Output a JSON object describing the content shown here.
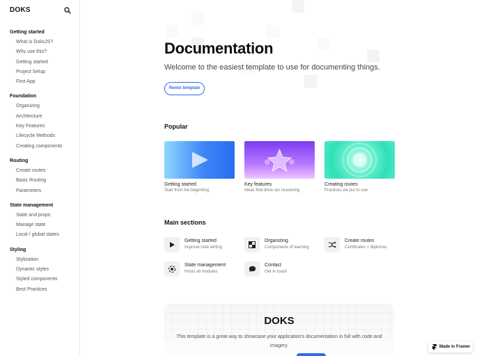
{
  "sidebar": {
    "brand": "DOKS",
    "groups": [
      {
        "title": "Getting started",
        "items": [
          "What is DoksJS?",
          "Why use this?",
          "Getting started",
          "Project Setup",
          "First App"
        ]
      },
      {
        "title": "Foundation",
        "items": [
          "Organizing",
          "Architecture",
          "Key Features",
          "Lifecycle Methods",
          "Creating components"
        ]
      },
      {
        "title": "Routing",
        "items": [
          "Create routes",
          "Basic Routing",
          "Parameters"
        ]
      },
      {
        "title": "State management",
        "items": [
          "State and props",
          "Manage state",
          "Local / global states"
        ]
      },
      {
        "title": "Styling",
        "items": [
          "Stylization",
          "Dynamic styles",
          "Styled components",
          "Best Practices"
        ]
      }
    ]
  },
  "hero": {
    "title": "Documentation",
    "subtitle": "Welcome to the easiest template to use for documenting things.",
    "remix_label": "Remix template"
  },
  "popular": {
    "heading": "Popular",
    "cards": [
      {
        "title": "Getting started",
        "subtitle": "Start from the beginning",
        "icon": "play-icon",
        "colors": [
          "#7fd3ff",
          "#2f7ff5"
        ]
      },
      {
        "title": "Key features",
        "subtitle": "Ideas that drive our reasoning",
        "icon": "star-icon",
        "colors": [
          "#7b3ff2",
          "#e7b8ff"
        ]
      },
      {
        "title": "Creating routes",
        "subtitle": "Practices we put to use",
        "icon": "target-icon",
        "colors": [
          "#2ee6c0",
          "#c9fff0"
        ]
      }
    ]
  },
  "main_sections": {
    "heading": "Main sections",
    "items": [
      {
        "title": "Getting started",
        "subtitle": "Improve note writing",
        "icon": "play-icon"
      },
      {
        "title": "Organizing",
        "subtitle": "Components of learning",
        "icon": "checker-icon"
      },
      {
        "title": "Create routes",
        "subtitle": "Certificates + diplomas",
        "icon": "shuffle-icon"
      },
      {
        "title": "State management",
        "subtitle": "Hosts all modules",
        "icon": "record-icon"
      },
      {
        "title": "Contact",
        "subtitle": "Get in touch",
        "icon": "chat-icon"
      }
    ]
  },
  "promo": {
    "title": "DOKS",
    "text": "This template is a great way to showcase your application's documentation in full with code and imagery."
  },
  "framer_badge": {
    "label": "Made in Framer"
  },
  "colors": {
    "accent": "#2f6bf0"
  }
}
